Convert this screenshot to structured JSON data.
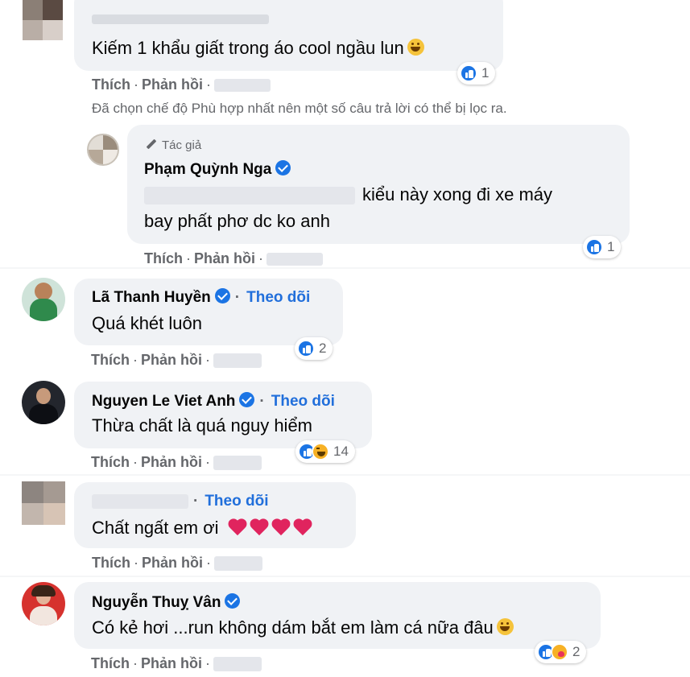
{
  "comments": [
    {
      "name": "",
      "text": "Kiếm 1 khẩu giất trong áo cool ngầu lun",
      "reaction_count": "1",
      "actions": {
        "like": "Thích",
        "reply": "Phản hồi",
        "sep": "·"
      }
    },
    {
      "is_author": true,
      "author_tag": "Tác giả",
      "name": "Phạm Quỳnh Nga",
      "text_line1": "kiểu này xong đi xe máy",
      "text_line2": "bay phất phơ dc ko anh",
      "reaction_count": "1",
      "actions": {
        "like": "Thích",
        "reply": "Phản hồi",
        "sep": "·"
      }
    },
    {
      "name": "Lã Thanh Huyền",
      "follow": "Theo dõi",
      "text": "Quá khét luôn",
      "reaction_count": "2",
      "actions": {
        "like": "Thích",
        "reply": "Phản hồi",
        "sep": "·"
      }
    },
    {
      "name": "Nguyen Le Viet Anh",
      "follow": "Theo dõi",
      "text": "Thừa chất là quá nguy hiểm",
      "reaction_count": "14",
      "actions": {
        "like": "Thích",
        "reply": "Phản hồi",
        "sep": "·"
      }
    },
    {
      "name": "",
      "follow": "Theo dõi",
      "text": "Chất ngất em ơi",
      "reaction_count": "",
      "actions": {
        "like": "Thích",
        "reply": "Phản hồi",
        "sep": "·"
      }
    },
    {
      "name": "Nguyễn Thuỵ Vân",
      "text": "Có kẻ hơi ...run không dám bắt em làm cá nữa đâu",
      "reaction_count": "2",
      "actions": {
        "like": "Thích",
        "reply": "Phản hồi",
        "sep": "·"
      }
    }
  ],
  "filter_notice": "Đã chọn chế độ Phù hợp nhất nên một số câu trả lời có thể bị lọc ra.",
  "colors": {
    "link_blue": "#216fdb",
    "verified_blue": "#1b74e4",
    "bubble_bg": "#f0f2f5",
    "meta_gray": "#65676b"
  },
  "icons": [
    "verified-badge-icon",
    "like-reaction-icon",
    "haha-reaction-icon",
    "care-reaction-icon",
    "heart-emoji",
    "laughing-emoji",
    "grinning-emoji",
    "pencil-icon"
  ]
}
